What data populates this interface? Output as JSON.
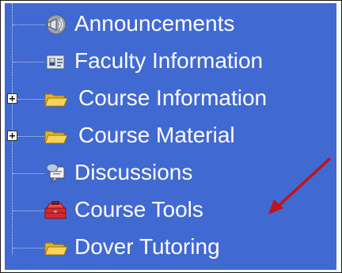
{
  "nav": {
    "items": [
      {
        "label": "Announcements",
        "icon": "megaphone-icon",
        "expandable": false
      },
      {
        "label": "Faculty Information",
        "icon": "faculty-card-icon",
        "expandable": false
      },
      {
        "label": "Course Information",
        "icon": "folder-icon",
        "expandable": true
      },
      {
        "label": "Course Material",
        "icon": "folder-icon",
        "expandable": true
      },
      {
        "label": "Discussions",
        "icon": "discussion-icon",
        "expandable": false
      },
      {
        "label": "Course Tools",
        "icon": "toolbox-icon",
        "expandable": false
      },
      {
        "label": "Dover Tutoring",
        "icon": "folder-icon",
        "expandable": false
      }
    ]
  },
  "colors": {
    "panel_background": "#4169d2",
    "label_text": "#ffffff",
    "annotation_arrow": "#c0141c"
  }
}
